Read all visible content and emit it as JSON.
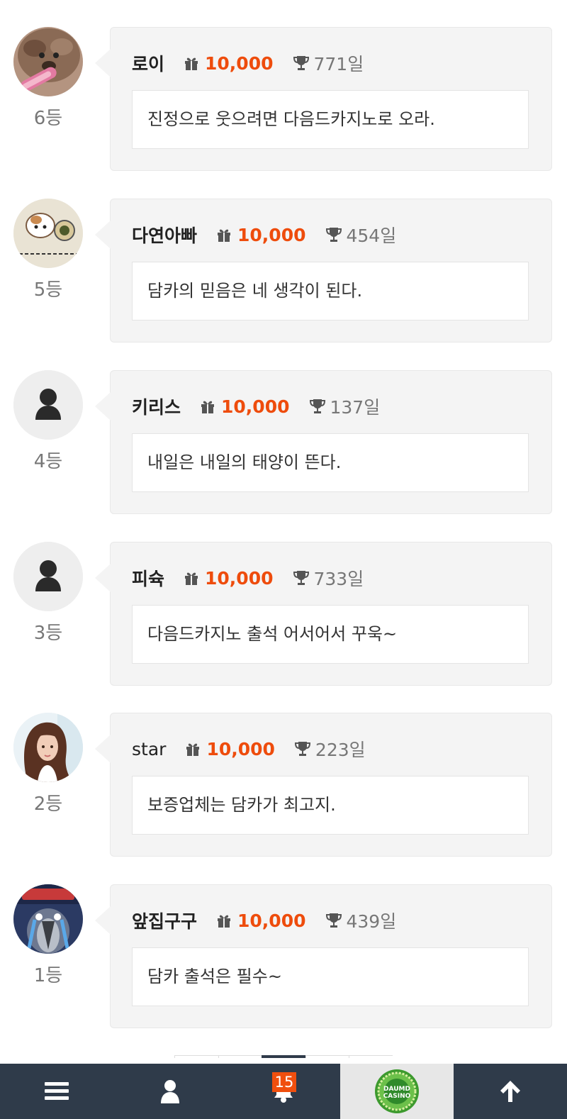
{
  "entries": [
    {
      "rank": "6등",
      "nickname": "로이",
      "points": "10,000",
      "days": "771일",
      "message": "진정으로 웃으려면 다음드카지노로 오라.",
      "avatar": "puppy-photo"
    },
    {
      "rank": "5등",
      "nickname": "다연아빠",
      "points": "10,000",
      "days": "454일",
      "message": "담카의 믿음은 네 생각이 된다.",
      "avatar": "hamster-cartoon"
    },
    {
      "rank": "4등",
      "nickname": "키리스",
      "points": "10,000",
      "days": "137일",
      "message": "내일은 내일의 태양이 뜬다.",
      "avatar": "default-user"
    },
    {
      "rank": "3등",
      "nickname": "피슉",
      "points": "10,000",
      "days": "733일",
      "message": "다음드카지노 출석 어서어서 꾸욱~",
      "avatar": "default-user"
    },
    {
      "rank": "2등",
      "nickname": "star",
      "points": "10,000",
      "days": "223일",
      "message": "보증업체는 담카가 최고지.",
      "avatar": "woman-photo"
    },
    {
      "rank": "1등",
      "nickname": "앞집구구",
      "points": "10,000",
      "days": "439일",
      "message": "담카 출석은 필수~",
      "avatar": "crying-penguin-cartoon"
    }
  ],
  "bottom_nav": {
    "notification_count": "15",
    "logo_text_top": "DAUMD",
    "logo_text_bottom": "CASINO",
    "items": [
      "menu-icon",
      "user-icon",
      "bell-icon",
      "casino-logo",
      "arrow-up-icon"
    ]
  },
  "colors": {
    "accent": "#ee4c0c",
    "nav_bg": "#2f3b4a",
    "card_bg": "#f4f4f4"
  }
}
